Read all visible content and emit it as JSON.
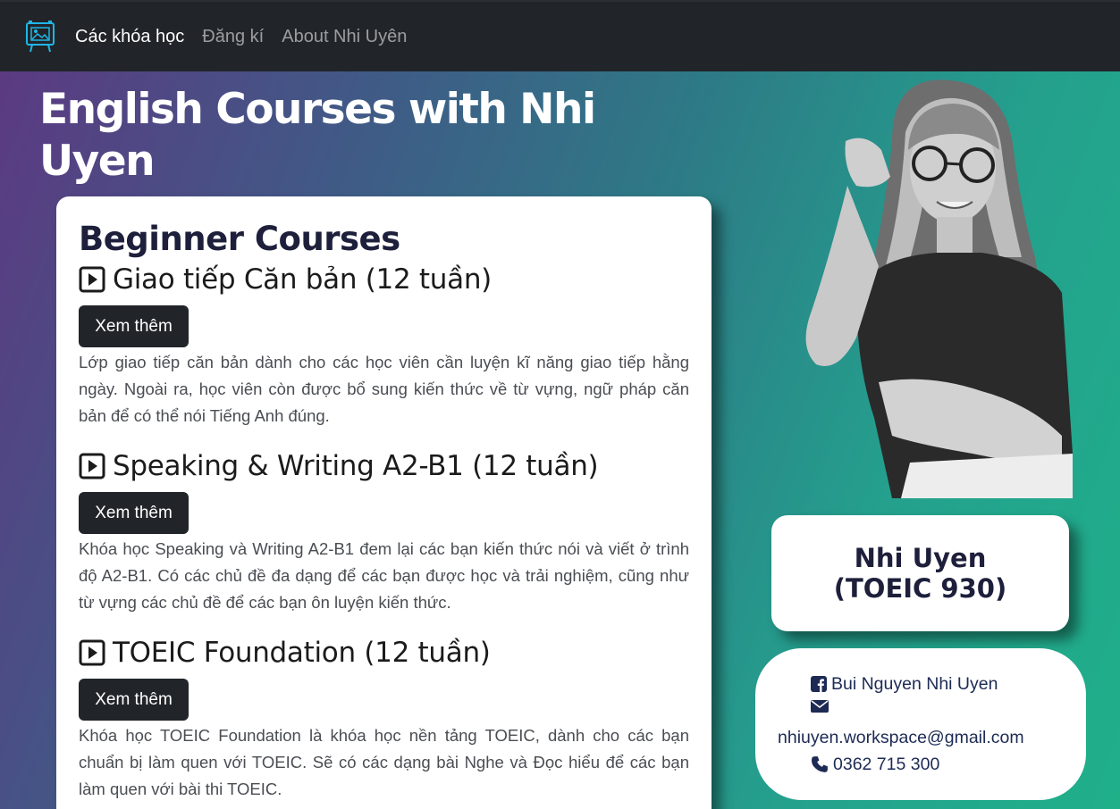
{
  "nav": {
    "logo_icon": "image-presentation-icon",
    "links": [
      {
        "label": "Các khóa học",
        "active": true
      },
      {
        "label": "Đăng kí",
        "active": false
      },
      {
        "label": "About Nhi Uyên",
        "active": false
      }
    ]
  },
  "hero": {
    "title": "English Courses with Nhi Uyen"
  },
  "courses": {
    "heading": "Beginner Courses",
    "items": [
      {
        "title": "Giao tiếp Căn bản (12 tuần)",
        "button": "Xem thêm",
        "description": "Lớp giao tiếp căn bản dành cho các học viên cần luyện kĩ năng giao tiếp hằng ngày. Ngoài ra, học viên còn được bổ sung kiến thức về từ vựng, ngữ pháp căn bản để có thể nói Tiếng Anh đúng."
      },
      {
        "title": "Speaking & Writing A2-B1 (12 tuần)",
        "button": "Xem thêm",
        "description": "Khóa học Speaking và Writing A2-B1 đem lại các bạn kiến thức nói và viết ở trình độ A2-B1. Có các chủ đề đa dạng để các bạn được học và trải nghiệm, cũng như từ vựng các chủ đề để các bạn ôn luyện kiến thức."
      },
      {
        "title": "TOEIC Foundation (12 tuần)",
        "button": "Xem thêm",
        "description": "Khóa học TOEIC Foundation là khóa học nền tảng TOEIC, dành cho các bạn chuẩn bị làm quen với TOEIC. Sẽ có các dạng bài Nghe và Đọc hiểu để các bạn làm quen với bài thi TOEIC."
      }
    ]
  },
  "profile": {
    "name_line1": "Nhi Uyen",
    "name_line2": "(TOEIC 930)",
    "facebook": "Bui Nguyen Nhi Uyen",
    "email": "nhiuyen.workspace@gmail.com",
    "phone": "0362 715 300"
  },
  "colors": {
    "navbar": "#212529",
    "accent_dark": "#1d1f3b",
    "gradient_start": "#5b3a82",
    "gradient_end": "#1fb08a"
  }
}
